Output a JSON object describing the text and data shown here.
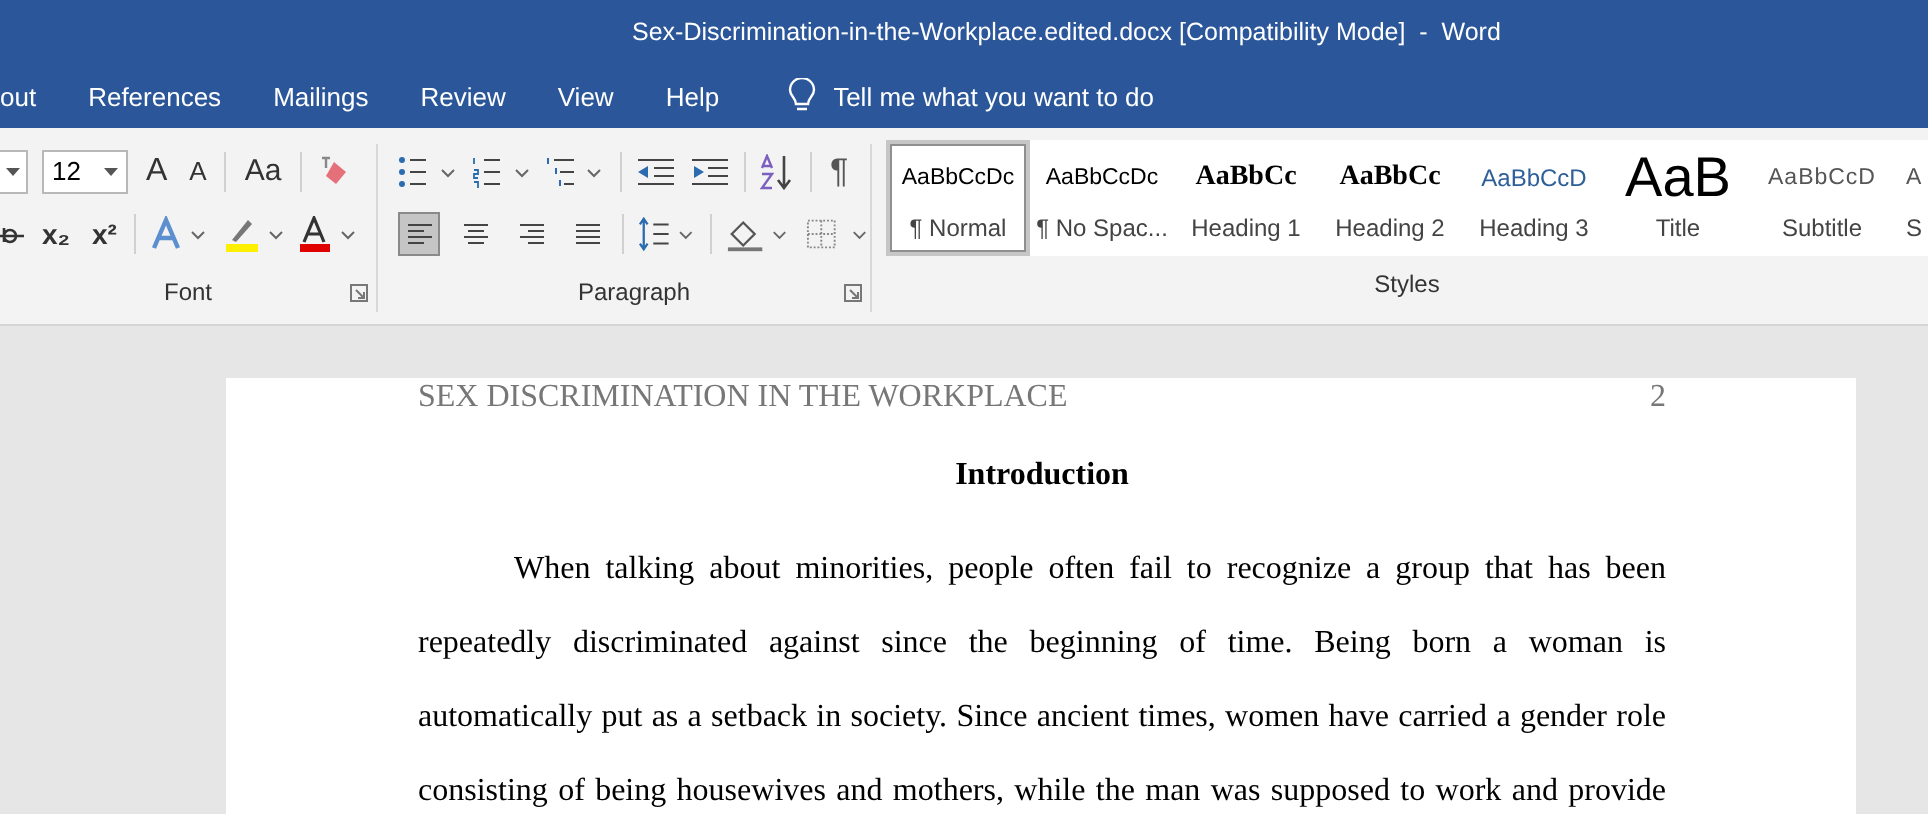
{
  "window": {
    "title": "Sex-Discrimination-in-the-Workplace.edited.docx [Compatibility Mode]  -  Word"
  },
  "tabs": [
    {
      "label": "out",
      "selected": false
    },
    {
      "label": "References",
      "selected": false
    },
    {
      "label": "Mailings",
      "selected": false
    },
    {
      "label": "Review",
      "selected": false
    },
    {
      "label": "View",
      "selected": false
    },
    {
      "label": "Help",
      "selected": false
    }
  ],
  "tell_me": {
    "placeholder": "Tell me what you want to do"
  },
  "font_group": {
    "font_size": "12",
    "grow": "A",
    "shrink": "A",
    "change_case": "Aa",
    "subscript": "x₂",
    "superscript": "x²",
    "label": "Font"
  },
  "paragraph_group": {
    "pilcrow": "¶",
    "label": "Paragraph",
    "alignment": [
      {
        "kind": "left",
        "selected": true
      },
      {
        "kind": "center",
        "selected": false
      },
      {
        "kind": "right",
        "selected": false
      },
      {
        "kind": "justify",
        "selected": false
      }
    ]
  },
  "styles_group": {
    "label": "Styles",
    "items": [
      {
        "kind": "normal",
        "preview": "AaBbCcDc",
        "name": "¶ Normal",
        "selected": true
      },
      {
        "kind": "normal",
        "preview": "AaBbCcDc",
        "name": "¶ No Spac...",
        "selected": false
      },
      {
        "kind": "heading1",
        "preview": "AaBbCc",
        "name": "Heading 1",
        "selected": false
      },
      {
        "kind": "heading2",
        "preview": "AaBbCc",
        "name": "Heading 2",
        "selected": false
      },
      {
        "kind": "heading3",
        "preview": "AaBbCcD",
        "name": "Heading 3",
        "selected": false
      },
      {
        "kind": "title",
        "preview": "AaB",
        "name": "Title",
        "selected": false
      },
      {
        "kind": "subtitle",
        "preview": "AaBbCcD",
        "name": "Subtitle",
        "selected": false
      },
      {
        "kind": "subtitle",
        "preview": "A",
        "name": "S",
        "selected": false
      }
    ]
  },
  "document": {
    "running_head": "SEX DISCRIMINATION IN THE WORKPLACE",
    "page_number": "2",
    "heading": "Introduction",
    "paragraph": "When talking about minorities, people often fail to recognize a group that has been repeatedly discriminated against since the beginning of time. Being born a woman is automatically put as a setback in society. Since ancient times, women have carried a gender role consisting of being housewives and mothers, while the man was supposed to work and provide"
  }
}
